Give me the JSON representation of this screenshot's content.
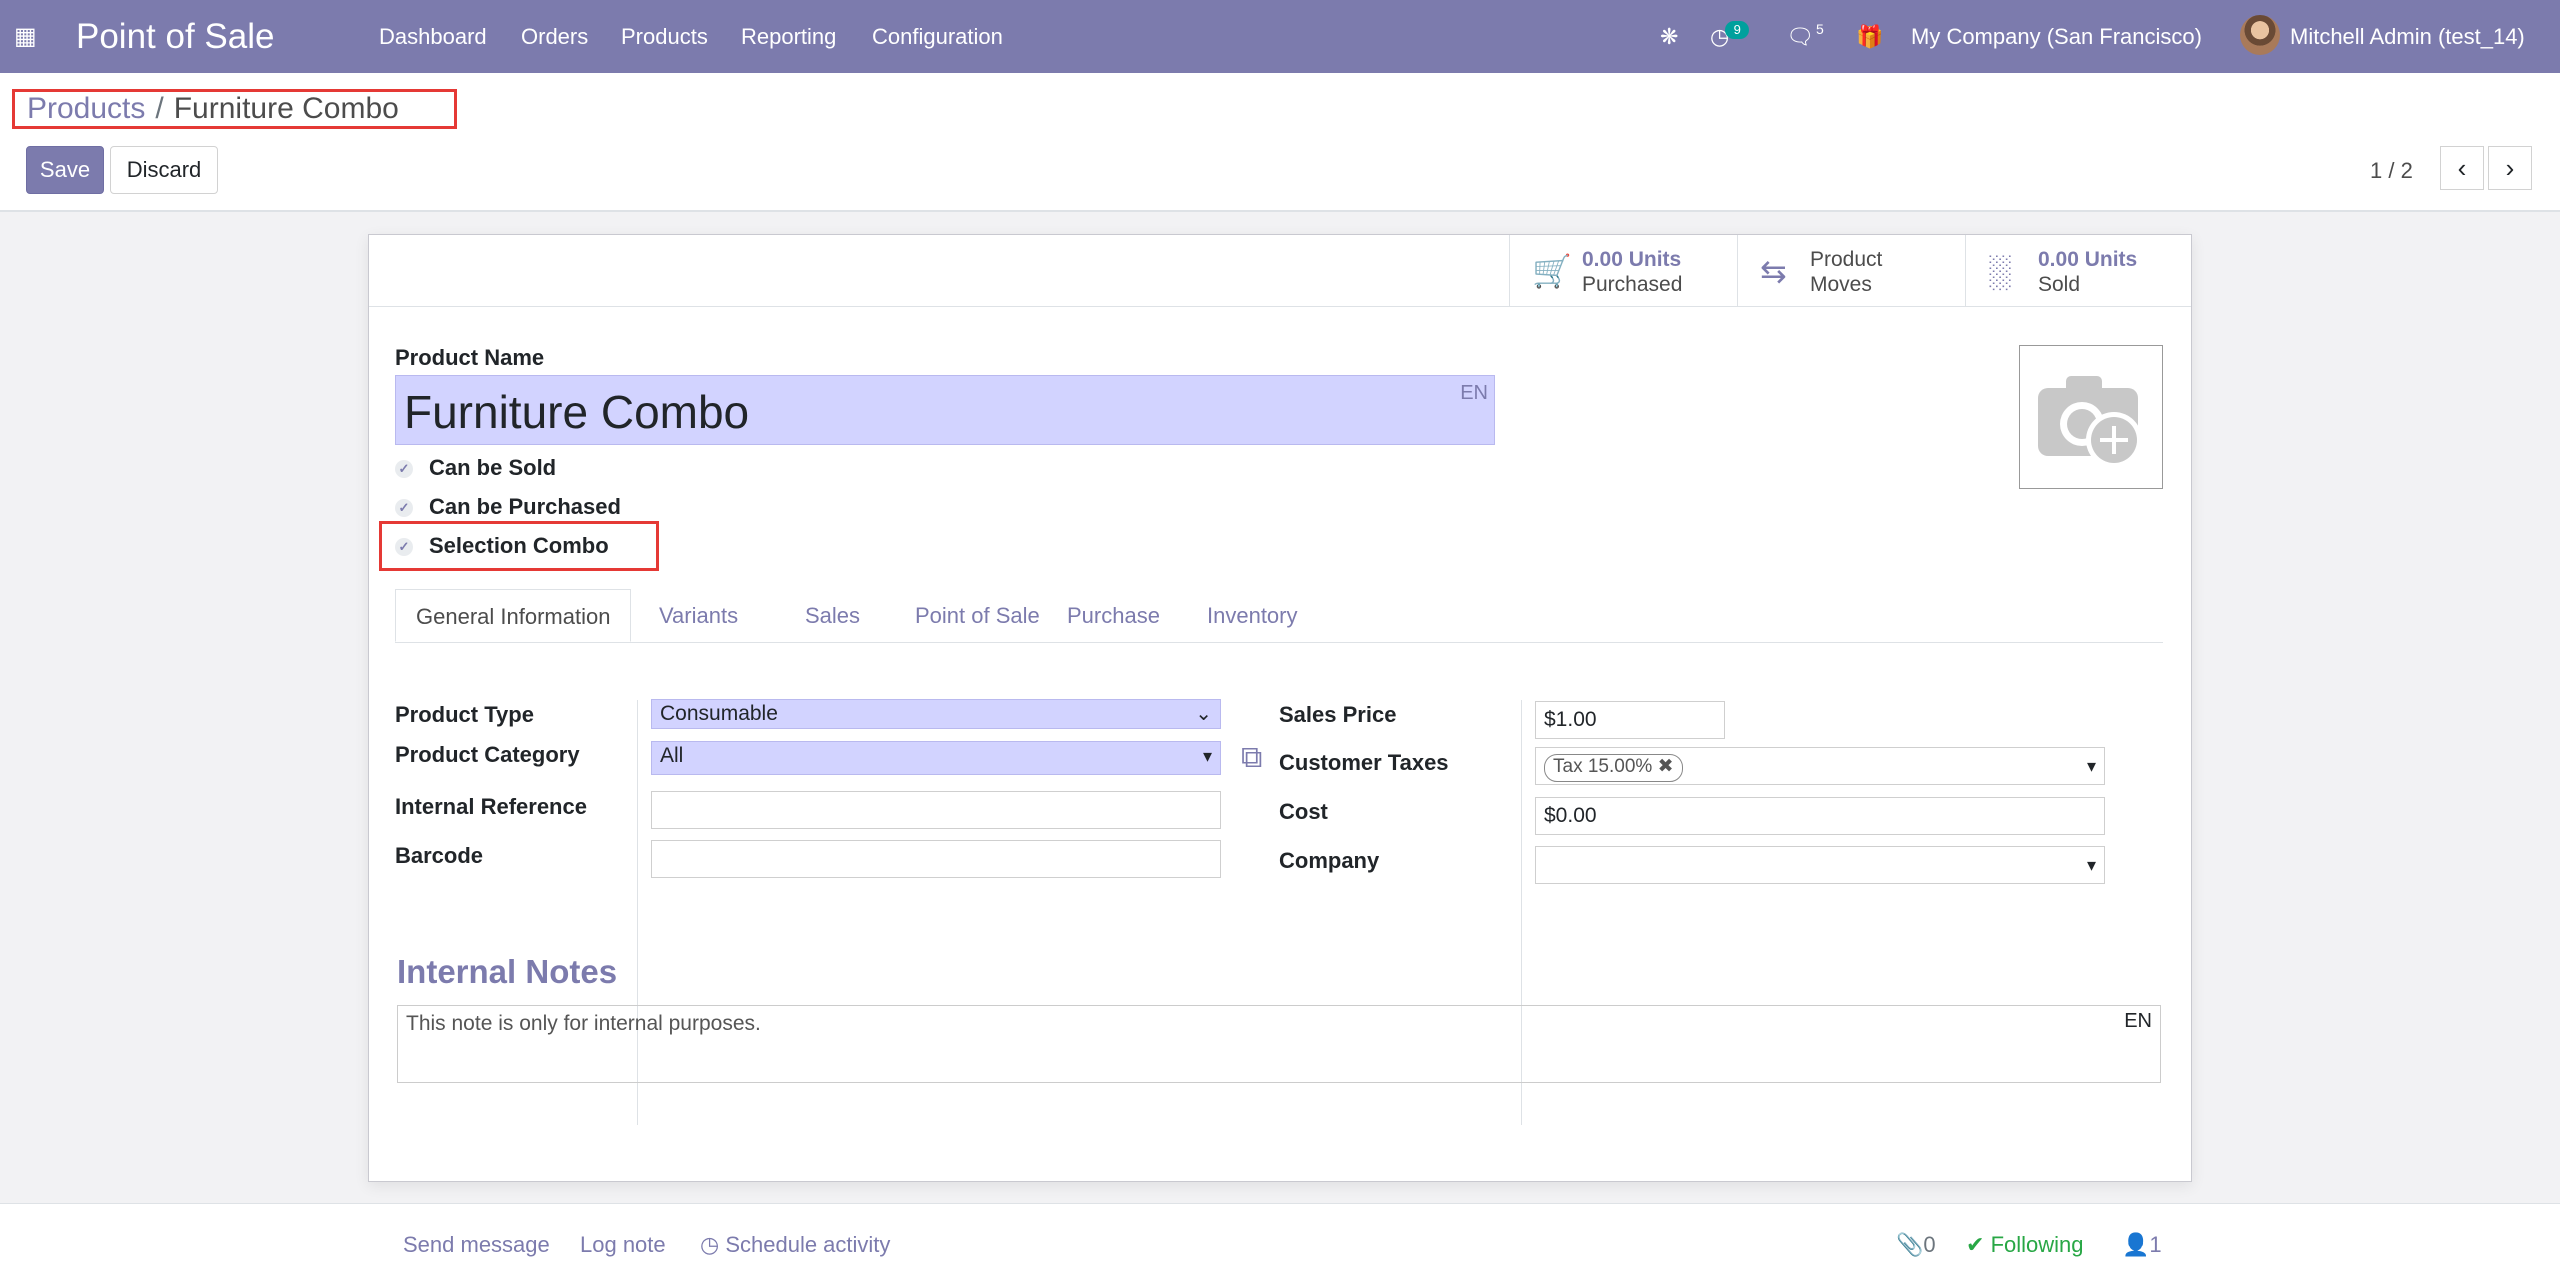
{
  "navbar": {
    "app_name": "Point of Sale",
    "menu": [
      "Dashboard",
      "Orders",
      "Products",
      "Reporting",
      "Configuration"
    ],
    "activity_count": "9",
    "message_count": "5",
    "company": "My Company (San Francisco)",
    "user": "Mitchell Admin (test_14)"
  },
  "breadcrumb": {
    "parent": "Products",
    "separator": "/",
    "current": "Furniture Combo"
  },
  "actions": {
    "save": "Save",
    "discard": "Discard"
  },
  "pager": {
    "value": "1 / 2"
  },
  "stat_buttons": [
    {
      "value": "0.00 Units",
      "label": "Purchased",
      "icon": "cart-icon"
    },
    {
      "value": "Product",
      "label": "Moves",
      "icon": "exchange-icon"
    },
    {
      "value": "0.00 Units",
      "label": "Sold",
      "icon": "bar-chart-icon"
    }
  ],
  "product": {
    "name_label": "Product Name",
    "name": "Furniture Combo",
    "lang": "EN",
    "checks": [
      {
        "label": "Can be Sold",
        "checked": true
      },
      {
        "label": "Can be Purchased",
        "checked": true
      },
      {
        "label": "Selection Combo",
        "checked": true
      }
    ]
  },
  "tabs": [
    "General Information",
    "Variants",
    "Sales",
    "Point of Sale",
    "Purchase",
    "Inventory"
  ],
  "general": {
    "product_type": {
      "label": "Product Type",
      "value": "Consumable"
    },
    "product_category": {
      "label": "Product Category",
      "value": "All"
    },
    "internal_reference": {
      "label": "Internal Reference",
      "value": ""
    },
    "barcode": {
      "label": "Barcode",
      "value": ""
    },
    "sales_price": {
      "label": "Sales Price",
      "value": "$1.00"
    },
    "customer_taxes": {
      "label": "Customer Taxes",
      "tag": "Tax 15.00%"
    },
    "cost": {
      "label": "Cost",
      "value": "$0.00"
    },
    "company": {
      "label": "Company",
      "value": ""
    }
  },
  "notes": {
    "title": "Internal Notes",
    "placeholder": "This note is only for internal purposes.",
    "lang": "EN"
  },
  "chatter": {
    "send_message": "Send message",
    "log_note": "Log note",
    "schedule_activity": "Schedule activity",
    "attachments": "0",
    "following": "Following",
    "followers": "1"
  },
  "colors": {
    "brand": "#7c7bad",
    "highlight_field": "#d2d3ff",
    "annotation": "#e53935",
    "following": "#28a745"
  }
}
